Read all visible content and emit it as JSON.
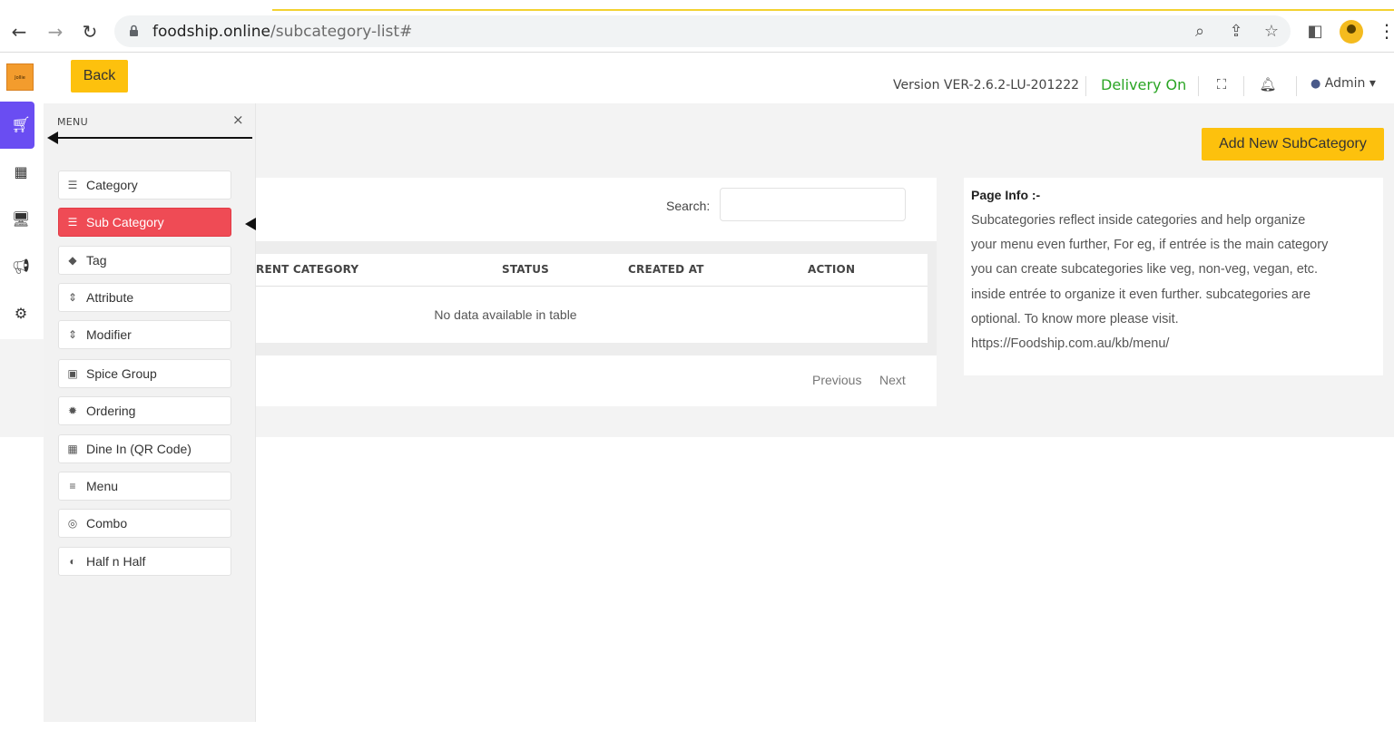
{
  "browser": {
    "url_domain": "foodship.online",
    "url_path": "/subcategory-list#"
  },
  "header": {
    "back_label": "Back",
    "version": "Version VER-2.6.2-LU-201222",
    "delivery_status": "Delivery On",
    "admin_label": "Admin ▾"
  },
  "logo": {
    "text": "Jollie"
  },
  "menu": {
    "title": "MENU",
    "close": "×",
    "items": [
      {
        "label": "Category",
        "icon": "list-icon",
        "glyph": "☰",
        "active": false
      },
      {
        "label": "Sub Category",
        "icon": "list-icon",
        "glyph": "☰",
        "active": true
      },
      {
        "label": "Tag",
        "icon": "tag-icon",
        "glyph": "◆",
        "active": false
      },
      {
        "label": "Attribute",
        "icon": "sort-icon",
        "glyph": "⇕",
        "active": false
      },
      {
        "label": "Modifier",
        "icon": "sort-icon",
        "glyph": "⇕",
        "active": false
      },
      {
        "label": "Spice Group",
        "icon": "spice-icon",
        "glyph": "▣",
        "active": false
      },
      {
        "label": "Ordering",
        "icon": "ordering-icon",
        "glyph": "✹",
        "active": false
      },
      {
        "label": "Dine In (QR Code)",
        "icon": "qr-icon",
        "glyph": "▦",
        "active": false
      },
      {
        "label": "Menu",
        "icon": "menu-icon",
        "glyph": "≡",
        "active": false
      },
      {
        "label": "Combo",
        "icon": "combo-icon",
        "glyph": "◎",
        "active": false
      },
      {
        "label": "Half n Half",
        "icon": "half-icon",
        "glyph": "◐",
        "active": false
      }
    ]
  },
  "table": {
    "search_label": "Search:",
    "search_value": "",
    "columns": [
      "RENT CATEGORY",
      "STATUS",
      "CREATED AT",
      "ACTION"
    ],
    "empty_text": "No data available in table",
    "previous": "Previous",
    "next": "Next"
  },
  "actions": {
    "add_label": "Add New SubCategory"
  },
  "page_info": {
    "title": "Page Info :-",
    "lines": [
      "Subcategories reflect inside categories and help organize",
      "your menu even further, For eg, if entrée is the main category",
      "you can create subcategories like veg, non-veg, vegan, etc.",
      "inside entrée to organize it even further. subcategories are",
      "optional. To know more please visit.",
      "https://Foodship.com.au/kb/menu/"
    ]
  },
  "colors": {
    "accent_yellow": "#fdc10d",
    "active_red": "#ef4b55",
    "rail_active_purple": "#6a4df2",
    "delivery_green": "#2aa524"
  }
}
